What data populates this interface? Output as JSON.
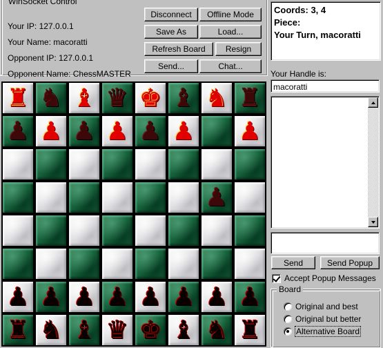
{
  "socket_panel": {
    "title": "WinSocket Control",
    "info": [
      "Your IP: 127.0.0.1",
      "Your Name: macoratti",
      "Opponent IP: 127.0.0.1",
      "Opponent Name: ChessMASTER"
    ],
    "buttons": [
      "Disconnect",
      "Offline Mode",
      "Save As",
      "Load...",
      "Refresh Board",
      "Resign",
      "Send...",
      "Chat..."
    ]
  },
  "status": {
    "coords": "Coords: 3, 4",
    "piece": "Piece:",
    "turn": "Your Turn, macoratti"
  },
  "handle": {
    "label": "Your Handle is:",
    "value": "macoratti"
  },
  "messages": {
    "log_value": "",
    "input_value": "",
    "send_label": "Send",
    "send_popup_label": "Send Popup",
    "accept_popup_label": "Accept Popup Messages",
    "accept_popup_checked": true
  },
  "board_group": {
    "title": "Board",
    "options": [
      {
        "label": "Original and best",
        "selected": false,
        "focused": false
      },
      {
        "label": "Original but better",
        "selected": false,
        "focused": false
      },
      {
        "label": "Alternative Board",
        "selected": true,
        "focused": true
      }
    ]
  },
  "colors": {
    "face": "#c0c0c0",
    "light_square": "#e8e8ea",
    "dark_square": "#19663f",
    "red_piece": "#e00000",
    "dark_piece": "#3d0808"
  },
  "chessboard": {
    "squares": 8,
    "square_size": 48,
    "rows": [
      [
        {
          "piece": "rook",
          "color": "red",
          "square": "light"
        },
        {
          "piece": "knight",
          "color": "maroon",
          "square": "dark"
        },
        {
          "piece": "bishop",
          "color": "red",
          "square": "light"
        },
        {
          "piece": "queen",
          "color": "maroon",
          "square": "dark"
        },
        {
          "piece": "king",
          "color": "red",
          "square": "light"
        },
        {
          "piece": "bishop",
          "color": "maroon",
          "square": "dark"
        },
        {
          "piece": "knight",
          "color": "red",
          "square": "light"
        },
        {
          "piece": "rook",
          "color": "maroon",
          "square": "dark"
        }
      ],
      [
        {
          "piece": "pawn",
          "color": "maroon",
          "square": "dark"
        },
        {
          "piece": "pawn",
          "color": "red",
          "square": "light"
        },
        {
          "piece": "pawn",
          "color": "maroon",
          "square": "dark"
        },
        {
          "piece": "pawn",
          "color": "red",
          "square": "light"
        },
        {
          "piece": "pawn",
          "color": "maroon",
          "square": "dark"
        },
        {
          "piece": "pawn",
          "color": "red",
          "square": "light"
        },
        {
          "piece": null,
          "color": null,
          "square": "dark"
        },
        {
          "piece": "pawn",
          "color": "red",
          "square": "light"
        }
      ],
      [
        {
          "piece": null,
          "color": null,
          "square": "light"
        },
        {
          "piece": null,
          "color": null,
          "square": "dark"
        },
        {
          "piece": null,
          "color": null,
          "square": "light"
        },
        {
          "piece": null,
          "color": null,
          "square": "dark"
        },
        {
          "piece": null,
          "color": null,
          "square": "light"
        },
        {
          "piece": null,
          "color": null,
          "square": "dark"
        },
        {
          "piece": null,
          "color": null,
          "square": "light"
        },
        {
          "piece": null,
          "color": null,
          "square": "dark"
        }
      ],
      [
        {
          "piece": null,
          "color": null,
          "square": "dark"
        },
        {
          "piece": null,
          "color": null,
          "square": "light"
        },
        {
          "piece": null,
          "color": null,
          "square": "dark"
        },
        {
          "piece": null,
          "color": null,
          "square": "light"
        },
        {
          "piece": null,
          "color": null,
          "square": "dark"
        },
        {
          "piece": null,
          "color": null,
          "square": "light"
        },
        {
          "piece": "pawn",
          "color": "maroon",
          "square": "dark"
        },
        {
          "piece": null,
          "color": null,
          "square": "light"
        }
      ],
      [
        {
          "piece": null,
          "color": null,
          "square": "light"
        },
        {
          "piece": null,
          "color": null,
          "square": "dark"
        },
        {
          "piece": null,
          "color": null,
          "square": "light"
        },
        {
          "piece": null,
          "color": null,
          "square": "dark"
        },
        {
          "piece": null,
          "color": null,
          "square": "light"
        },
        {
          "piece": null,
          "color": null,
          "square": "dark"
        },
        {
          "piece": null,
          "color": null,
          "square": "light"
        },
        {
          "piece": null,
          "color": null,
          "square": "dark"
        }
      ],
      [
        {
          "piece": null,
          "color": null,
          "square": "dark"
        },
        {
          "piece": null,
          "color": null,
          "square": "light"
        },
        {
          "piece": null,
          "color": null,
          "square": "dark"
        },
        {
          "piece": null,
          "color": null,
          "square": "light"
        },
        {
          "piece": null,
          "color": null,
          "square": "dark"
        },
        {
          "piece": null,
          "color": null,
          "square": "light"
        },
        {
          "piece": null,
          "color": null,
          "square": "dark"
        },
        {
          "piece": null,
          "color": null,
          "square": "light"
        }
      ],
      [
        {
          "piece": "pawn",
          "color": "blackred",
          "square": "light"
        },
        {
          "piece": "pawn",
          "color": "blackred",
          "square": "dark"
        },
        {
          "piece": "pawn",
          "color": "blackred",
          "square": "light"
        },
        {
          "piece": "pawn",
          "color": "blackred",
          "square": "dark"
        },
        {
          "piece": "pawn",
          "color": "blackred",
          "square": "light"
        },
        {
          "piece": "pawn",
          "color": "blackred",
          "square": "dark"
        },
        {
          "piece": "pawn",
          "color": "blackred",
          "square": "light"
        },
        {
          "piece": "pawn",
          "color": "blackred",
          "square": "dark"
        }
      ],
      [
        {
          "piece": "rook",
          "color": "blackred",
          "square": "dark"
        },
        {
          "piece": "knight",
          "color": "blackred",
          "square": "light"
        },
        {
          "piece": "bishop",
          "color": "blackred",
          "square": "dark"
        },
        {
          "piece": "queen",
          "color": "blackred",
          "square": "light"
        },
        {
          "piece": "king",
          "color": "blackred",
          "square": "dark"
        },
        {
          "piece": "bishop",
          "color": "blackred",
          "square": "light"
        },
        {
          "piece": "knight",
          "color": "blackred",
          "square": "dark"
        },
        {
          "piece": "rook",
          "color": "blackred",
          "square": "light"
        }
      ]
    ]
  }
}
